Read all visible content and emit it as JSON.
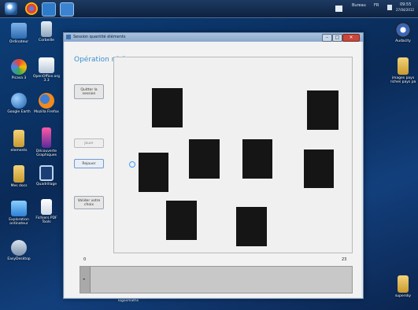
{
  "taskbar": {
    "start_icon": "windows-orb-icon",
    "pinned": [
      "chrome-icon",
      "app-icon",
      "app-icon-2"
    ],
    "tray_text": "Bureau",
    "tray_lang": "FR",
    "clock_time": "09:55",
    "clock_date": "27/04/2012"
  },
  "desktop_left": [
    {
      "label": "Ordinateur",
      "icon": "computer-icon"
    },
    {
      "label": "Corbeille",
      "icon": "recycle-bin-icon"
    },
    {
      "label": "Picasa 3",
      "icon": "picasa-icon"
    },
    {
      "label": "OpenOffice.org 3.3",
      "icon": "openoffice-icon"
    },
    {
      "label": "Google Earth",
      "icon": "google-earth-icon"
    },
    {
      "label": "Mozilla Firefox",
      "icon": "firefox-icon"
    },
    {
      "label": "elements",
      "icon": "folder-icon"
    },
    {
      "label": "Découverte Graphiques",
      "icon": "app-icon"
    },
    {
      "label": "Mes docs",
      "icon": "folder-icon"
    },
    {
      "label": "Quadrillage",
      "icon": "app-icon"
    },
    {
      "label": "Exploration ordinateur",
      "icon": "app-icon"
    },
    {
      "label": "Fichiers PDF Tools",
      "icon": "file-icon"
    },
    {
      "label": "EasyDesktop",
      "icon": "app-icon"
    }
  ],
  "desktop_right": [
    {
      "label": "Audacity",
      "icon": "audacity-icon"
    },
    {
      "label": "images pays riches pays pa",
      "icon": "folder-icon"
    },
    {
      "label": "supersky",
      "icon": "folder-icon"
    }
  ],
  "window": {
    "title": "Session quantité éléments",
    "operation_title": "Opération n° 1",
    "buttons": {
      "quit": "Quitter la session",
      "jouer": "Jouer",
      "rejouer": "Rejouer",
      "valider": "Valider votre choix"
    },
    "scale_min": "0",
    "scale_max": "23",
    "progress_fraction": 0.0,
    "squares_count": 9,
    "colors": {
      "accent": "#3a8fd0",
      "square": "#151515"
    }
  },
  "taskbar_label_bottom": "logosmaths"
}
